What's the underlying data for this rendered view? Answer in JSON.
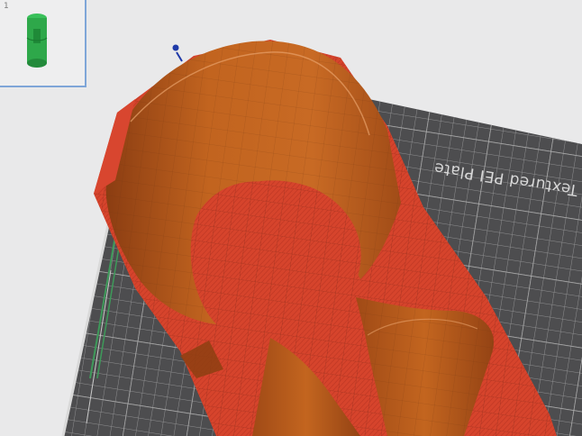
{
  "plate": {
    "label": "Textured PEI Plate"
  },
  "plate_list": {
    "items": [
      {
        "index": "1"
      }
    ]
  },
  "colors": {
    "background": "#e9e9ea",
    "bed": "#4d4d4f",
    "bed_grid": "#9a9a9a",
    "wall": "#b85a1f",
    "wall_dark": "#8d3f12",
    "overhang": "#d8462f",
    "thumbnail_model": "#2ea84a",
    "selection_border": "#7fa6d8",
    "gizmo": "#1f3aa8"
  },
  "icons": {
    "thumbnail": "green-cylinder-model",
    "gizmo": "axis-handle-icon"
  }
}
